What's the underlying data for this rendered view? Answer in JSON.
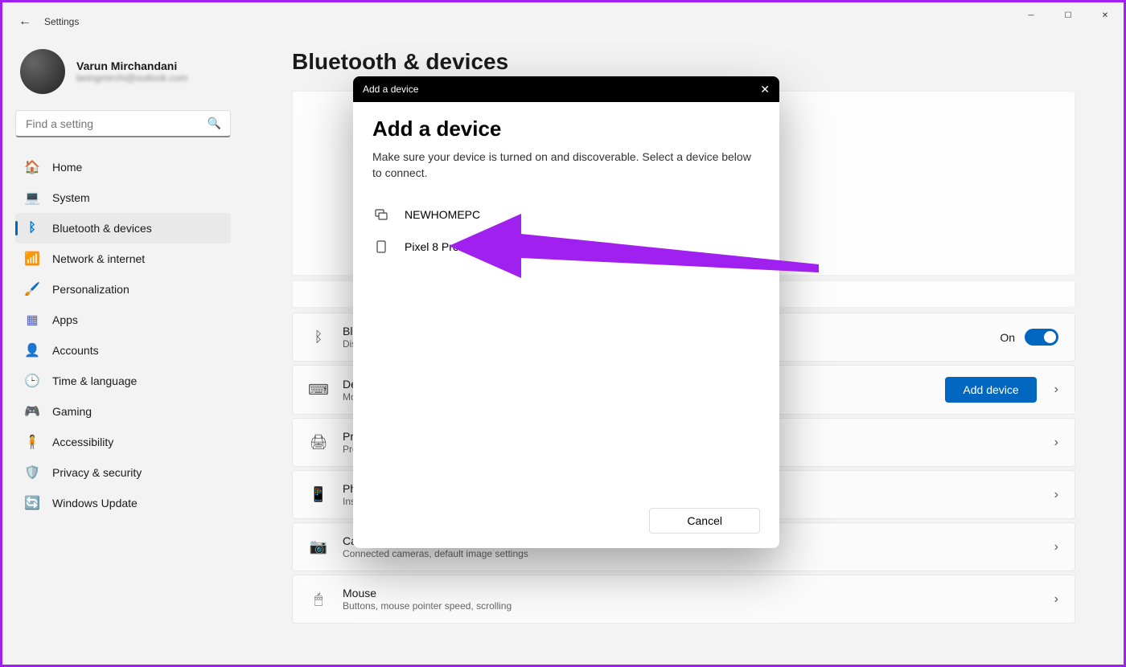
{
  "app": {
    "title": "Settings"
  },
  "user": {
    "name": "Varun Mirchandani",
    "email": "beingmirchi@outlook.com"
  },
  "search": {
    "placeholder": "Find a setting"
  },
  "nav": {
    "items": [
      {
        "label": "Home",
        "icon": "🏠"
      },
      {
        "label": "System",
        "icon": "💻"
      },
      {
        "label": "Bluetooth & devices",
        "icon": "ᛒ",
        "active": true
      },
      {
        "label": "Network & internet",
        "icon": "📶"
      },
      {
        "label": "Personalization",
        "icon": "🖌️"
      },
      {
        "label": "Apps",
        "icon": "▦"
      },
      {
        "label": "Accounts",
        "icon": "👤"
      },
      {
        "label": "Time & language",
        "icon": "🕒"
      },
      {
        "label": "Gaming",
        "icon": "🎮"
      },
      {
        "label": "Accessibility",
        "icon": "♿"
      },
      {
        "label": "Privacy & security",
        "icon": "🛡️"
      },
      {
        "label": "Windows Update",
        "icon": "🔄"
      }
    ]
  },
  "page": {
    "title": "Bluetooth & devices",
    "bluetooth": {
      "title": "Blu",
      "sub": "Dis",
      "toggle_label": "On"
    },
    "devices": {
      "title": "De",
      "sub": "Mo",
      "add_button": "Add device"
    },
    "printers": {
      "title": "Pri",
      "sub": "Pre"
    },
    "phone": {
      "title": "Ph",
      "sub": "Ins"
    },
    "cameras": {
      "title": "Cameras",
      "sub": "Connected cameras, default image settings"
    },
    "mouse": {
      "title": "Mouse",
      "sub": "Buttons, mouse pointer speed, scrolling"
    }
  },
  "dialog": {
    "header": "Add a device",
    "title": "Add a device",
    "description": "Make sure your device is turned on and discoverable. Select a device below to connect.",
    "devices": [
      {
        "name": "NEWHOMEPC",
        "type": "pc"
      },
      {
        "name": "Pixel 8 Pro",
        "type": "phone"
      }
    ],
    "cancel": "Cancel"
  },
  "colors": {
    "accent": "#0067c0",
    "annotation": "#a020f0"
  }
}
